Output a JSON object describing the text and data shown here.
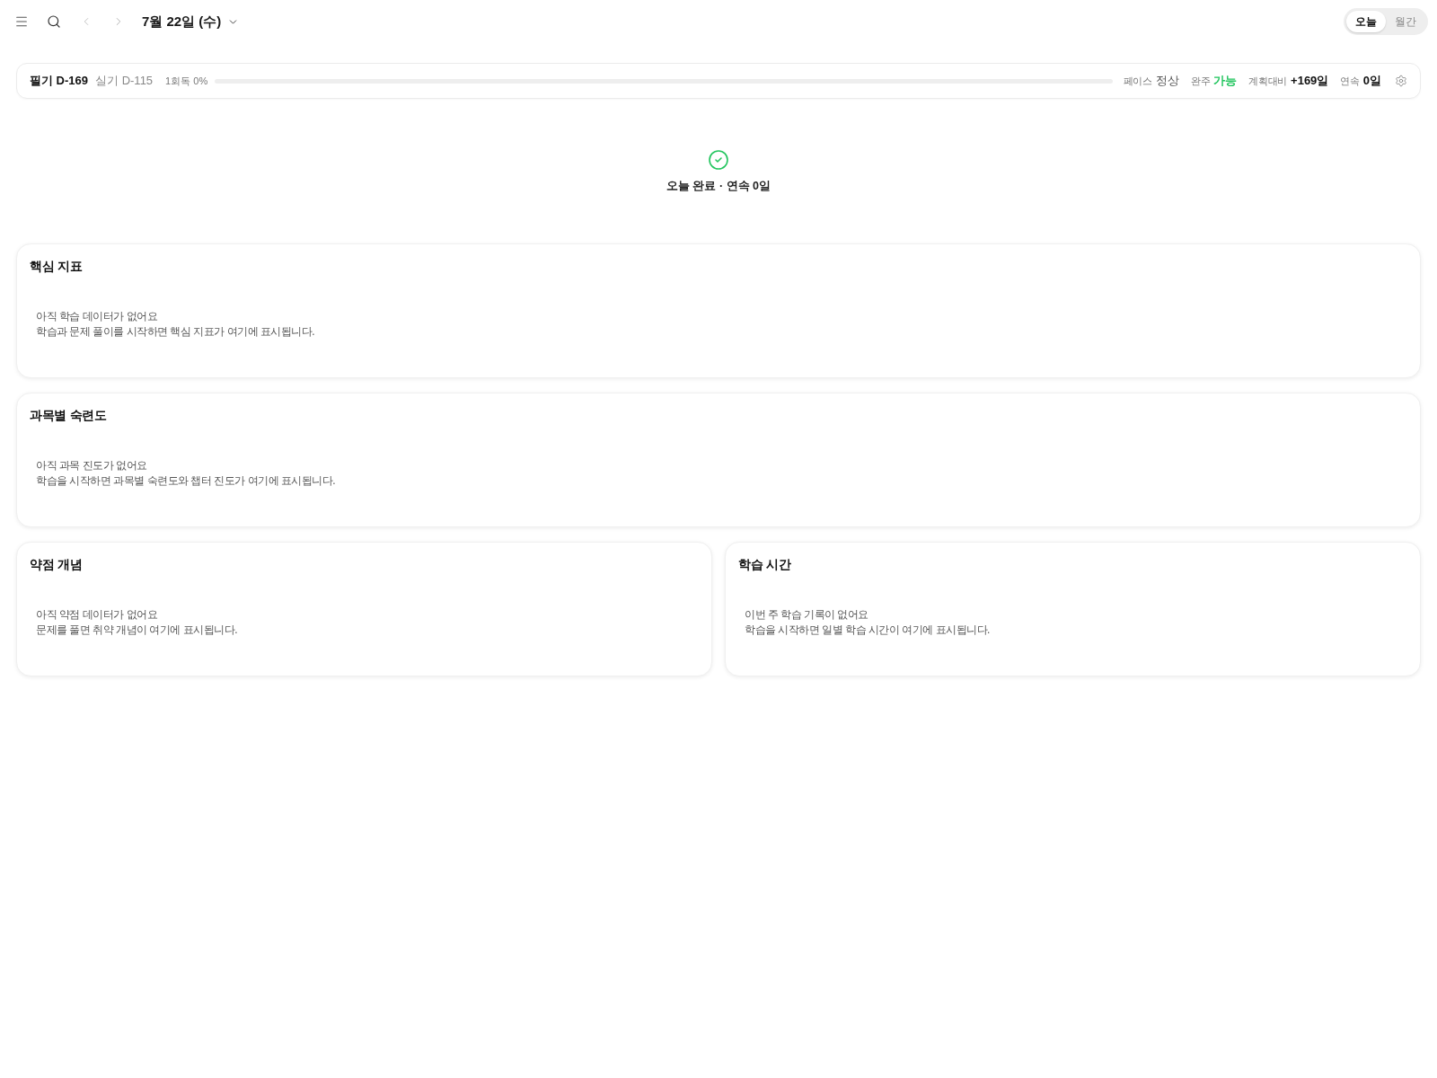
{
  "header": {
    "date": "7월 22일 (수)",
    "view_toggle": [
      {
        "label": "오늘",
        "selected": true
      },
      {
        "label": "월간",
        "selected": false
      }
    ]
  },
  "summary_bar": {
    "exams": [
      {
        "label": "필기 D-169",
        "primary": true
      },
      {
        "label": "실기 D-115",
        "primary": false
      }
    ],
    "progress": {
      "label": "1회독 0%"
    },
    "stats": [
      {
        "label": "페이스",
        "value": "정상",
        "kind": "plain"
      },
      {
        "label": "완주",
        "value": "가능",
        "kind": "good"
      },
      {
        "label": "계획대비",
        "value": "+169일",
        "kind": "strong"
      },
      {
        "label": "연속",
        "value": "0일",
        "kind": "strong"
      }
    ]
  },
  "today_status": {
    "completed": true,
    "text": "오늘 완료 · 연속 0일"
  },
  "cards": [
    {
      "title": "핵심 지표",
      "empty_lines": [
        "아직 학습 데이터가 없어요",
        "학습과 문제 풀이를 시작하면 핵심 지표가 여기에 표시됩니다."
      ]
    },
    {
      "title": "과목별 숙련도",
      "empty_lines": [
        "아직 과목 진도가 없어요",
        "학습을 시작하면 과목별 숙련도와 챕터 진도가 여기에 표시됩니다."
      ]
    },
    {
      "title": "약점 개념",
      "empty_lines": [
        "아직 약점 데이터가 없어요",
        "문제를 풀면 취약 개념이 여기에 표시됩니다."
      ]
    },
    {
      "title": "학습 시간",
      "empty_lines": [
        "이번 주 학습 기록이 없어요",
        "학습을 시작하면 일별 학습 시간이 여기에 표시됩니다."
      ]
    }
  ]
}
